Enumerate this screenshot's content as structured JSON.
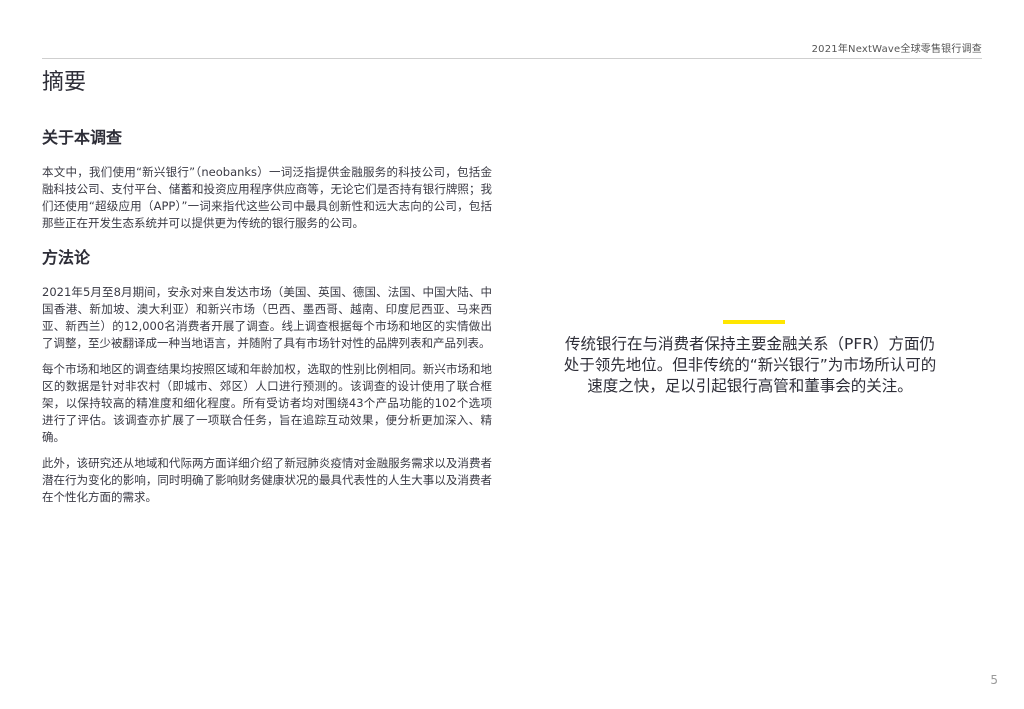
{
  "header": {
    "report_title": "2021年NextWave全球零售银行调查"
  },
  "page": {
    "heading": "摘要",
    "number": "5"
  },
  "sections": {
    "about": {
      "heading": "关于本调查",
      "paragraph": "本文中，我们使用“新兴银行”（neobanks）一词泛指提供金融服务的科技公司，包括金融科技公司、支付平台、储蓄和投资应用程序供应商等，无论它们是否持有银行牌照；我们还使用“超级应用（APP）”一词来指代这些公司中最具创新性和远大志向的公司，包括那些正在开发生态系统并可以提供更为传统的银行服务的公司。"
    },
    "methodology": {
      "heading": "方法论",
      "paragraphs": [
        "2021年5月至8月期间，安永对来自发达市场（美国、英国、德国、法国、中国大陆、中国香港、新加坡、澳大利亚）和新兴市场（巴西、墨西哥、越南、印度尼西亚、马来西亚、新西兰）的12,000名消费者开展了调查。线上调查根据每个市场和地区的实情做出了调整，至少被翻译成一种当地语言，并随附了具有市场针对性的品牌列表和产品列表。",
        "每个市场和地区的调查结果均按照区域和年龄加权，选取的性别比例相同。新兴市场和地区的数据是针对非农村（即城市、郊区）人口进行预测的。该调查的设计使用了联合框架，以保持较高的精准度和细化程度。所有受访者均对围绕43个产品功能的102个选项进行了评估。该调查亦扩展了一项联合任务，旨在追踪互动效果，便分析更加深入、精确。",
        "此外，该研究还从地域和代际两方面详细介绍了新冠肺炎疫情对金融服务需求以及消费者潜在行为变化的影响，同时明确了影响财务健康状况的最具代表性的人生大事以及消费者在个性化方面的需求。"
      ]
    }
  },
  "pull_quote": {
    "text": "传统银行在与消费者保持主要金融关系（PFR）方面仍处于领先地位。但非传统的“新兴银行”为市场所认可的速度之快，足以引起银行高管和董事会的关注。",
    "accent_color": "#ffe600"
  }
}
